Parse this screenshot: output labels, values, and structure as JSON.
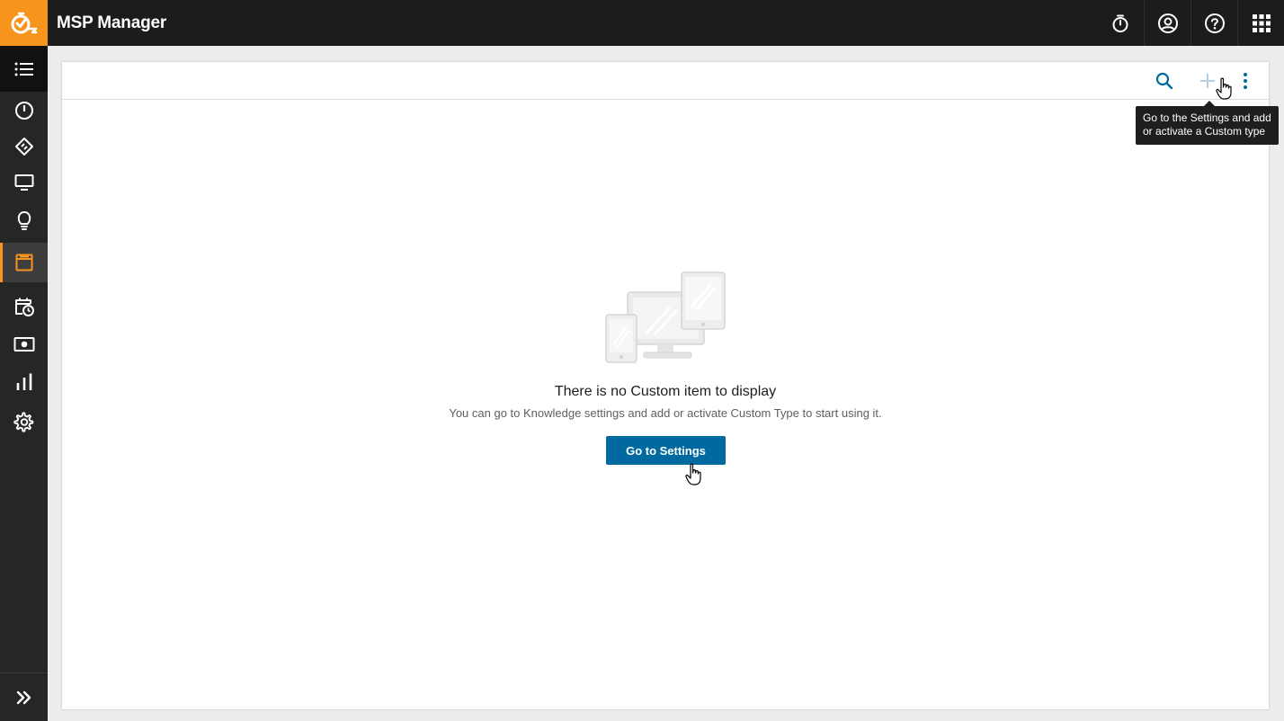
{
  "app": {
    "title": "MSP Manager"
  },
  "header": {
    "actions": [
      {
        "name": "timer",
        "icon": "stopwatch-icon"
      },
      {
        "name": "account",
        "icon": "user-circle-icon"
      },
      {
        "name": "help",
        "icon": "help-circle-icon"
      },
      {
        "name": "apps",
        "icon": "grid-icon"
      }
    ]
  },
  "sidebar": {
    "items": [
      {
        "name": "menu",
        "icon": "list-icon"
      },
      {
        "name": "dashboard",
        "icon": "gauge-icon"
      },
      {
        "name": "tickets",
        "icon": "ticket-icon"
      },
      {
        "name": "devices",
        "icon": "monitor-icon"
      },
      {
        "name": "ideas",
        "icon": "lightbulb-icon"
      },
      {
        "name": "knowledge",
        "icon": "book-icon",
        "active": true
      },
      {
        "name": "scheduling",
        "icon": "calendar-clock-icon"
      },
      {
        "name": "billing",
        "icon": "money-icon"
      },
      {
        "name": "reports",
        "icon": "bar-chart-icon"
      },
      {
        "name": "settings",
        "icon": "gear-icon"
      }
    ],
    "expand_icon": "double-chevron-right-icon"
  },
  "toolbar": {
    "tooltip": "Go to the Settings and add or activate a Custom type"
  },
  "empty_state": {
    "title": "There is no Custom item to display",
    "subtitle": "You can go to Knowledge settings and add or activate Custom Type to start using it.",
    "button_label": "Go to Settings"
  },
  "colors": {
    "accent": "#f7941d",
    "primary": "#006aa0",
    "topbar": "#1c1c1c",
    "sidebar": "#262626"
  }
}
